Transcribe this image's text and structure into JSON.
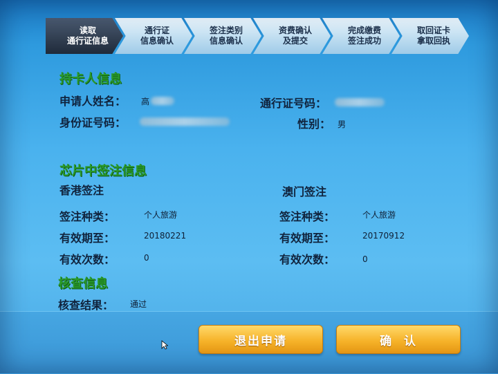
{
  "steps": [
    {
      "label": "读取\n通行证信息",
      "active": true
    },
    {
      "label": "通行证\n信息确认",
      "active": false
    },
    {
      "label": "签注类别\n信息确认",
      "active": false
    },
    {
      "label": "资费确认\n及提交",
      "active": false
    },
    {
      "label": "完成缴费\n签注成功",
      "active": false
    },
    {
      "label": "取回证卡\n拿取回执",
      "active": false
    }
  ],
  "holder": {
    "title": "持卡人信息",
    "name_label": "申请人姓名：",
    "name_value": "高",
    "permit_label": "通行证号码：",
    "id_label": "身份证号码：",
    "gender_label": "性别：",
    "gender_value": "男"
  },
  "chip": {
    "title": "芯片中签注信息",
    "hk": {
      "title": "香港签注",
      "type_label": "签注种类：",
      "type_value": "个人旅游",
      "valid_label": "有效期至：",
      "valid_value": "20180221",
      "count_label": "有效次数：",
      "count_value": "0"
    },
    "mo": {
      "title": "澳门签注",
      "type_label": "签注种类：",
      "type_value": "个人旅游",
      "valid_label": "有效期至：",
      "valid_value": "20170912",
      "count_label": "有效次数：",
      "count_value": "0"
    }
  },
  "verify": {
    "title": "核查信息",
    "result_label": "核查结果：",
    "result_value": "通过"
  },
  "buttons": {
    "exit": "退出申请",
    "confirm": "确  认"
  },
  "colors": {
    "section_title": "#2a9a2a",
    "button": "#f6b32a",
    "screen": "#4ab2ee"
  }
}
